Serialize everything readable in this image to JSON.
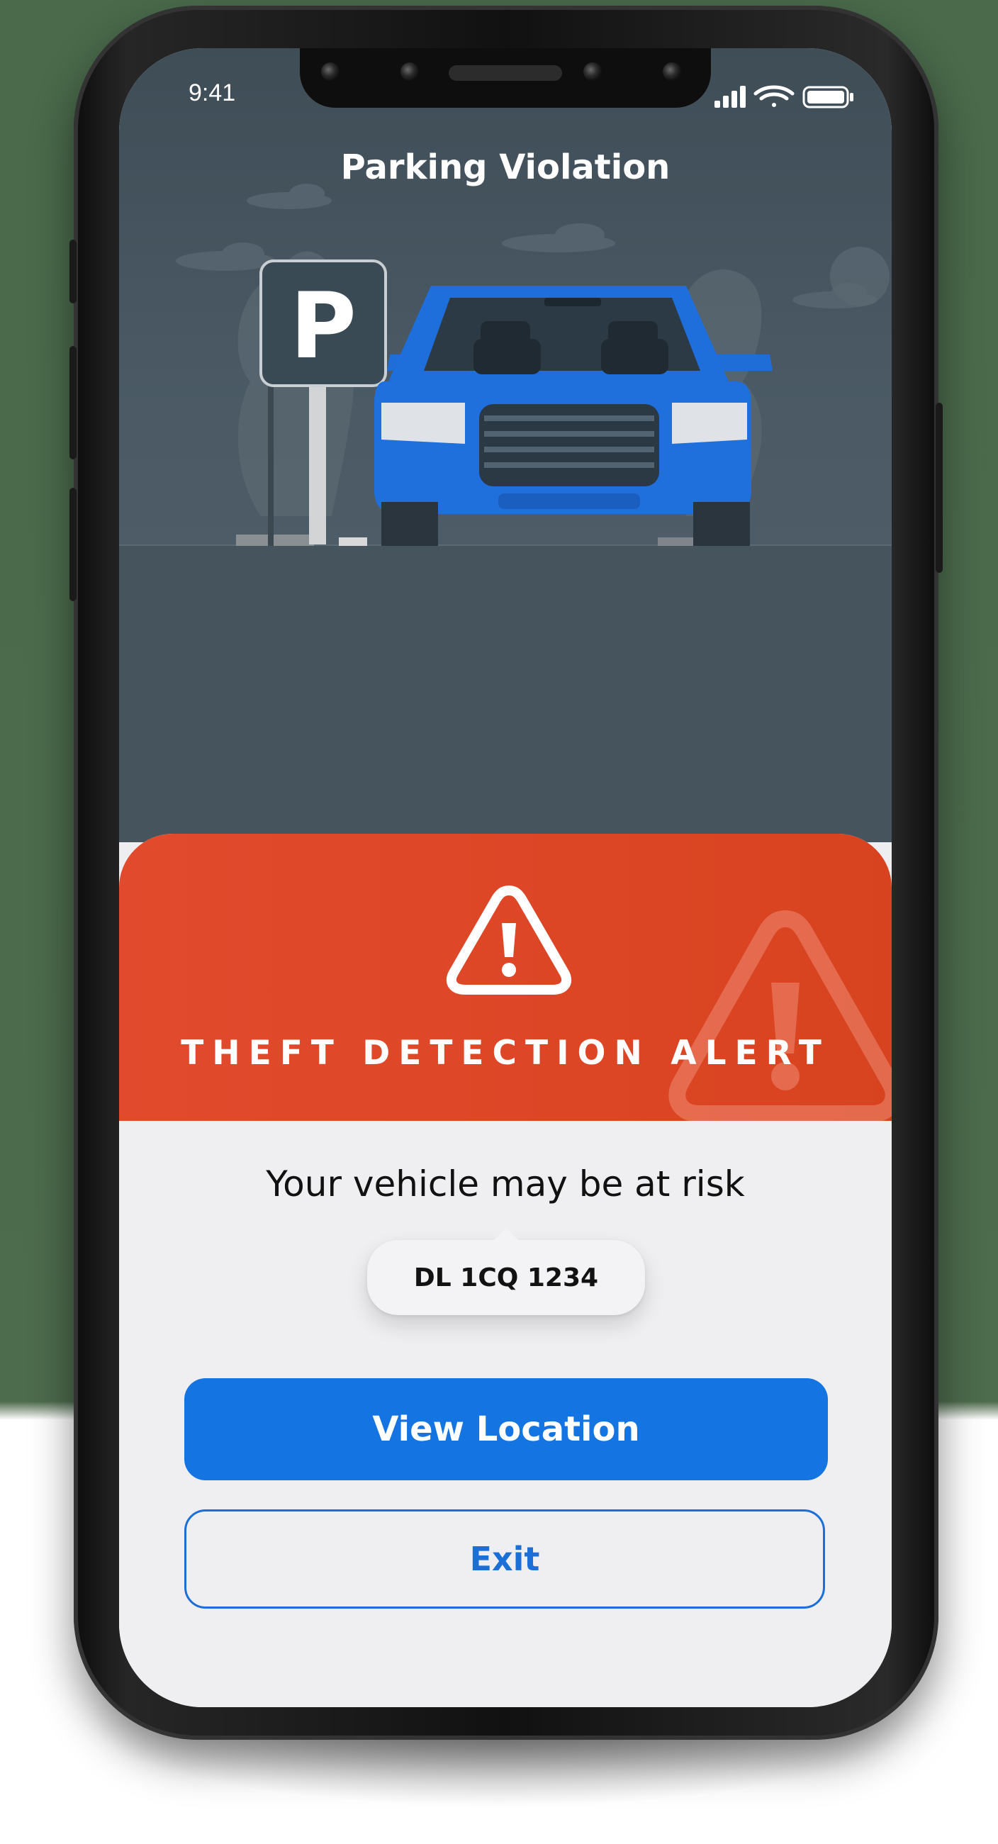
{
  "status_bar": {
    "time": "9:41",
    "signal_icon": "cellular-signal-icon",
    "wifi_icon": "wifi-icon",
    "battery_icon": "battery-icon"
  },
  "header": {
    "title": "Parking Violation"
  },
  "illustration": {
    "parking_sign_letter": "P",
    "car_icon": "car-icon"
  },
  "alert": {
    "icon": "warning-triangle-icon",
    "title": "THEFT DETECTION ALERT",
    "message": "Your vehicle may be at risk",
    "plate_number": "DL 1CQ 1234"
  },
  "actions": {
    "primary_label": "View Location",
    "secondary_label": "Exit"
  },
  "colors": {
    "accent_blue": "#1474e1",
    "alert_red": "#dd4726",
    "car_blue": "#1f6ed8",
    "scene_bg": "#4b5a65"
  }
}
